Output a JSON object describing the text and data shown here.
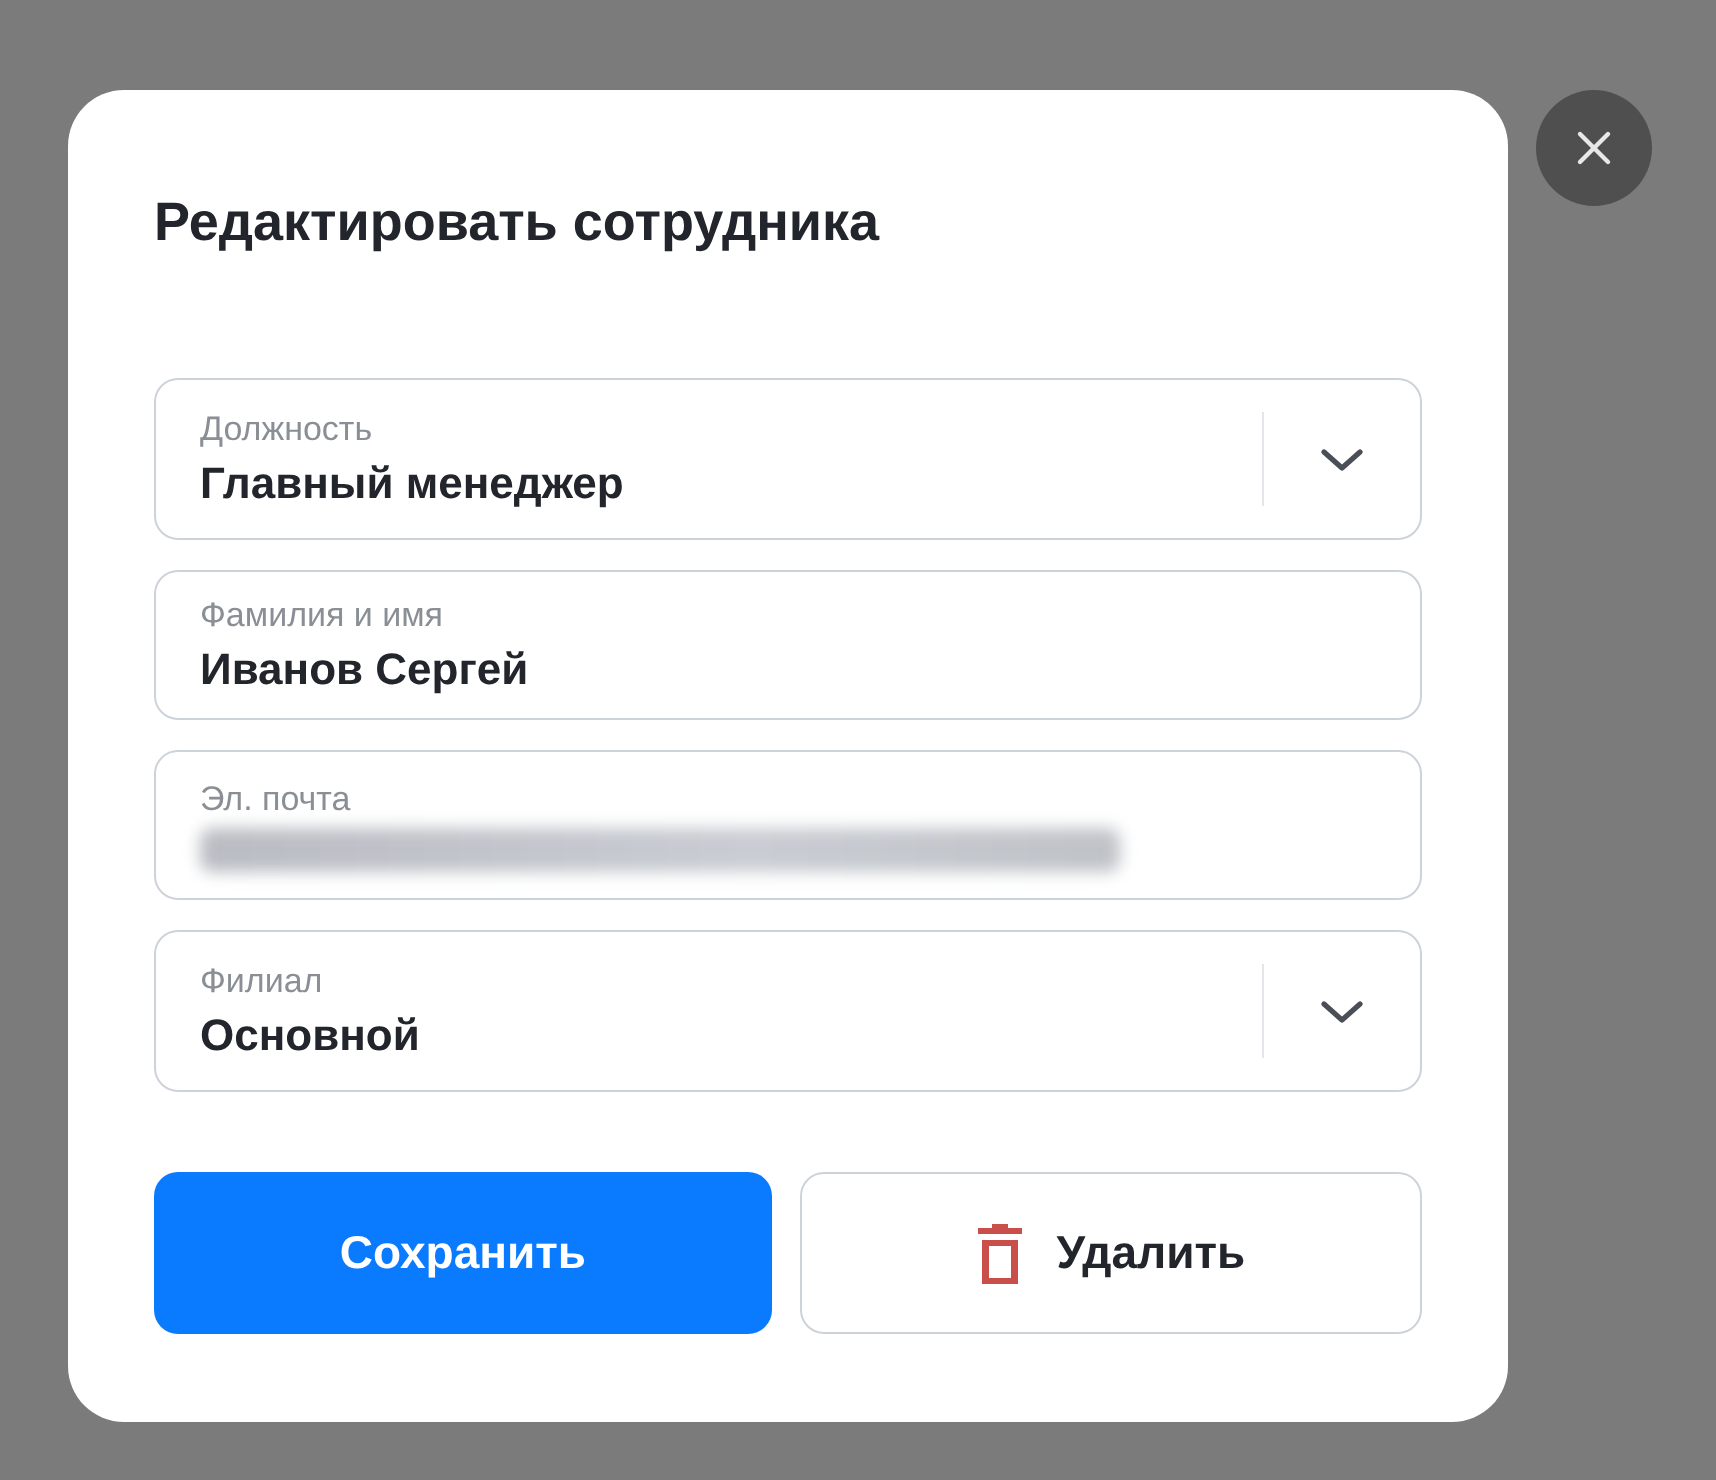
{
  "dialog": {
    "title": "Редактировать сотрудника"
  },
  "fields": [
    {
      "kind": "select",
      "label": "Должность",
      "value": "Главный менеджер"
    },
    {
      "kind": "text",
      "label": "Фамилия и имя",
      "value": "Иванов Сергей"
    },
    {
      "kind": "redacted",
      "label": "Эл. почта"
    },
    {
      "kind": "select",
      "label": "Филиал",
      "value": "Основной"
    }
  ],
  "buttons": [
    {
      "kind": "primary",
      "label": "Сохранить"
    },
    {
      "kind": "delete",
      "label": "Удалить"
    }
  ]
}
